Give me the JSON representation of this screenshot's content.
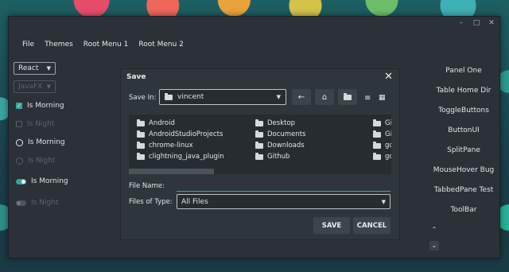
{
  "window": {
    "controls": {
      "minimize": "–",
      "maximize": "□",
      "close": "✕"
    }
  },
  "menubar": {
    "items": [
      "File",
      "Themes",
      "Root Menu 1",
      "Root Menu 2"
    ]
  },
  "left_panel": {
    "dropdown_react": "React",
    "dropdown_javafx": "JavaFX",
    "checkbox_checked_label": "Is Morning",
    "checkbox_disabled_label": "Is Night",
    "radio_on_label": "Is Morning",
    "radio_disabled_label": "Is Night",
    "toggle_on_label": "Is Morning",
    "toggle_disabled_label": "Is Night"
  },
  "right_panel": {
    "items": [
      "Panel One",
      "Table Home Dir",
      "ToggleButtons",
      "ButtonUI",
      "SplitPane",
      "MouseHover Bug",
      "TabbedPane Test",
      "ToolBar"
    ],
    "scroll_up": "⌃",
    "scroll_down": "⌄"
  },
  "dialog": {
    "title": "Save",
    "close": "✕",
    "save_in_label": "Save In:",
    "save_in_value": "vincent",
    "files": {
      "col1": [
        "Android",
        "AndroidStudioProjects",
        "chrome-linux",
        "clightning_java_plugin"
      ],
      "col2": [
        "Desktop",
        "Documents",
        "Downloads",
        "Github"
      ],
      "col3": [
        "Gi",
        "Gi",
        "gc",
        "gc"
      ]
    },
    "file_name_label": "File Name:",
    "file_name_value": "",
    "files_of_type_label": "Files of Type:",
    "files_of_type_value": "All Files",
    "save_button": "SAVE",
    "cancel_button": "CANCEL"
  },
  "colors": {
    "accent": "#37a59c",
    "background": "#2b3136"
  }
}
